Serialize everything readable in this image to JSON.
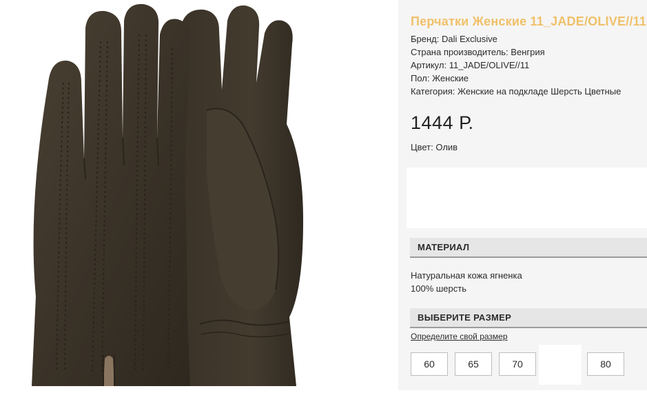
{
  "product": {
    "title": "Перчатки Женские 11_JADE/OLIVE//11",
    "brand": "Бренд: Dali Exclusive",
    "country": "Страна производитель: Венгрия",
    "article": "Артикул: 11_JADE/OLIVE//11",
    "gender": "Пол: Женские",
    "category": "Категория: Женские на подкладе Шерсть Цветные",
    "price": "1444 Р.",
    "color": "Цвет: Олив"
  },
  "material": {
    "heading": "МАТЕРИАЛ",
    "lines": [
      "Натуральная кожа ягненка",
      "100% шерсть"
    ]
  },
  "size": {
    "heading": "ВЫБЕРИТЕ РАЗМЕР",
    "link": "Определите свой размер",
    "options": [
      "60",
      "65",
      "70",
      "80"
    ]
  },
  "image": {
    "icon": "leather-gloves-photo",
    "leather_color": "#3e362b",
    "stitch_color": "#2a241c",
    "lining_color": "#8a7560"
  },
  "colors": {
    "title_accent": "#f0c16a",
    "panel_bg": "#f5f5f5",
    "section_bg": "#e6e6e6"
  }
}
